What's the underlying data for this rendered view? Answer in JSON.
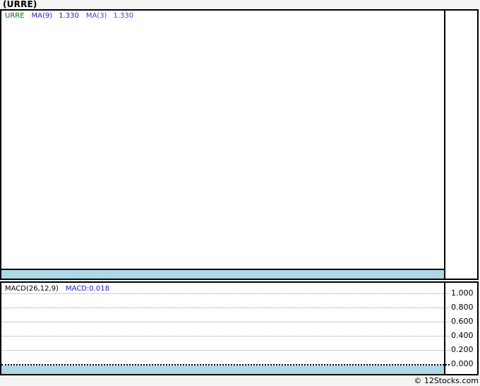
{
  "title": "(URRE)",
  "price_panel": {
    "legend": {
      "symbol": "URRE",
      "ma9_label": "MA(9)",
      "ma9_value": "1.330",
      "ma3_label": "MA(3)",
      "ma3_value": "1.330"
    }
  },
  "macd_panel": {
    "label": "MACD(26,12,9)",
    "value": "MACD:0.018",
    "axis_ticks": [
      "1.000",
      "0.800",
      "0.600",
      "0.400",
      "0.200",
      "0.000"
    ]
  },
  "footer": {
    "copyright": "© 12Stocks.com"
  },
  "colors": {
    "symbol_green": "#007700",
    "ma9_blue": "#2222CC",
    "ma3_purple": "#6633CC",
    "macd_value_blue": "#2222CC",
    "date_band_blue": "#ADD8E6",
    "page_background": "#F4F4F4",
    "panel_background": "#FFFFFF",
    "border_black": "#000000",
    "gridline_gray": "#999999"
  },
  "chart_data": {
    "type": "line",
    "title": "(URRE)",
    "panels": [
      {
        "name": "price",
        "series": [
          {
            "name": "URRE",
            "color": "#007700",
            "current_value": null
          },
          {
            "name": "MA(9)",
            "color": "#2222CC",
            "current_value": 1.33
          },
          {
            "name": "MA(3)",
            "color": "#6633CC",
            "current_value": 1.33
          }
        ],
        "note": "no plotted price data visible in panel",
        "legend_position": "top-left"
      },
      {
        "name": "MACD(26,12,9)",
        "current_value": 0.018,
        "yticks": [
          1.0,
          0.8,
          0.6,
          0.4,
          0.2,
          0.0
        ],
        "ylim": [
          -0.12,
          1.1
        ],
        "grid": "dotted horizontal gridlines, darker dotted zero line",
        "note": "no plotted MACD data visible in panel",
        "legend_position": "top-left"
      }
    ],
    "x_axis": "date bands shown as empty light-blue strips at bottom of each panel"
  }
}
